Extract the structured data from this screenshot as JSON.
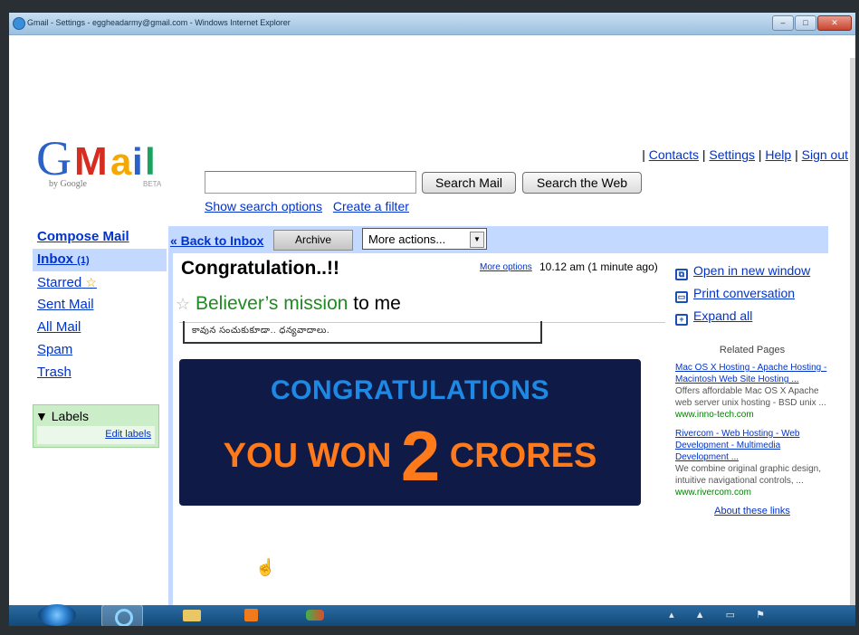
{
  "window": {
    "title": "Gmail - Settings - eggheadarmy@gmail.com - Windows Internet Explorer"
  },
  "header": {
    "logo": {
      "text": "Gmail",
      "by": "by Google",
      "beta": "BETA"
    },
    "top_links": [
      "Contacts",
      "Settings",
      "Help",
      "Sign out"
    ],
    "search": {
      "placeholder": "",
      "search_mail": "Search Mail",
      "search_web": "Search the Web"
    },
    "sub_links": [
      "Show search options",
      "Create a filter"
    ]
  },
  "sidebar": {
    "compose": "Compose Mail",
    "items": [
      {
        "label": "Inbox",
        "count": "(1)"
      },
      {
        "label": "Starred"
      },
      {
        "label": "Sent Mail"
      },
      {
        "label": "All Mail"
      },
      {
        "label": "Spam"
      },
      {
        "label": "Trash"
      }
    ],
    "labels_header": "Labels",
    "edit_labels": "Edit labels"
  },
  "toolbar": {
    "back": "« Back to Inbox",
    "archive": "Archive",
    "more_actions": "More actions..."
  },
  "message": {
    "subject": "Congratulation..!!",
    "more_options": "More options",
    "time": "10.12 am (1 minute ago)",
    "sender": "Believer’s mission",
    "to": "to me",
    "body_snippet": "కావున సంచుకుకూడా.. ధన్యవాదాలు.",
    "banner_line1": "CONGRATULATIONS",
    "banner_you_won": "YOU WON",
    "banner_number": "2",
    "banner_crores": "CRORES",
    "colors": {
      "banner_bg": "#0f1a46",
      "banner_blue": "#1e88e5",
      "banner_orange": "#ff7a1a",
      "sender_green": "#1f8a1f"
    }
  },
  "right": {
    "links": [
      "Open in new window",
      "Print conversation",
      "Expand all"
    ],
    "related_header": "Related Pages",
    "ads": [
      {
        "title": "Mac OS X Hosting - Apache Hosting - Macintosh Web Site Hosting ...",
        "desc": "Offers affordable Mac OS X Apache web server unix hosting - BSD unix ...",
        "url": "www.inno-tech.com"
      },
      {
        "title": "Rivercom - Web Hosting - Web Development - Multimedia Development ...",
        "desc": "We combine original graphic design, intuitive navigational controls, ...",
        "url": "www.rivercom.com"
      }
    ],
    "about": "About these links"
  },
  "taskbar": {
    "tray": "▴ ▲ ▭ ⚑"
  }
}
